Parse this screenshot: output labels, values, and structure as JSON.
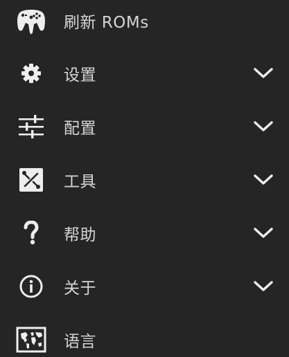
{
  "menu": {
    "items": [
      {
        "label": "刷新 ROMs",
        "icon": "gamepad-icon",
        "expandable": false
      },
      {
        "label": "设置",
        "icon": "gear-icon",
        "expandable": true
      },
      {
        "label": "配置",
        "icon": "sliders-icon",
        "expandable": true
      },
      {
        "label": "工具",
        "icon": "tools-icon",
        "expandable": true
      },
      {
        "label": "帮助",
        "icon": "question-icon",
        "expandable": true
      },
      {
        "label": "关于",
        "icon": "info-icon",
        "expandable": true
      },
      {
        "label": "语言",
        "icon": "world-map-icon",
        "expandable": false
      }
    ]
  },
  "colors": {
    "background": "#252525",
    "text": "#d6d6d6",
    "icon": "#eeeeee"
  }
}
